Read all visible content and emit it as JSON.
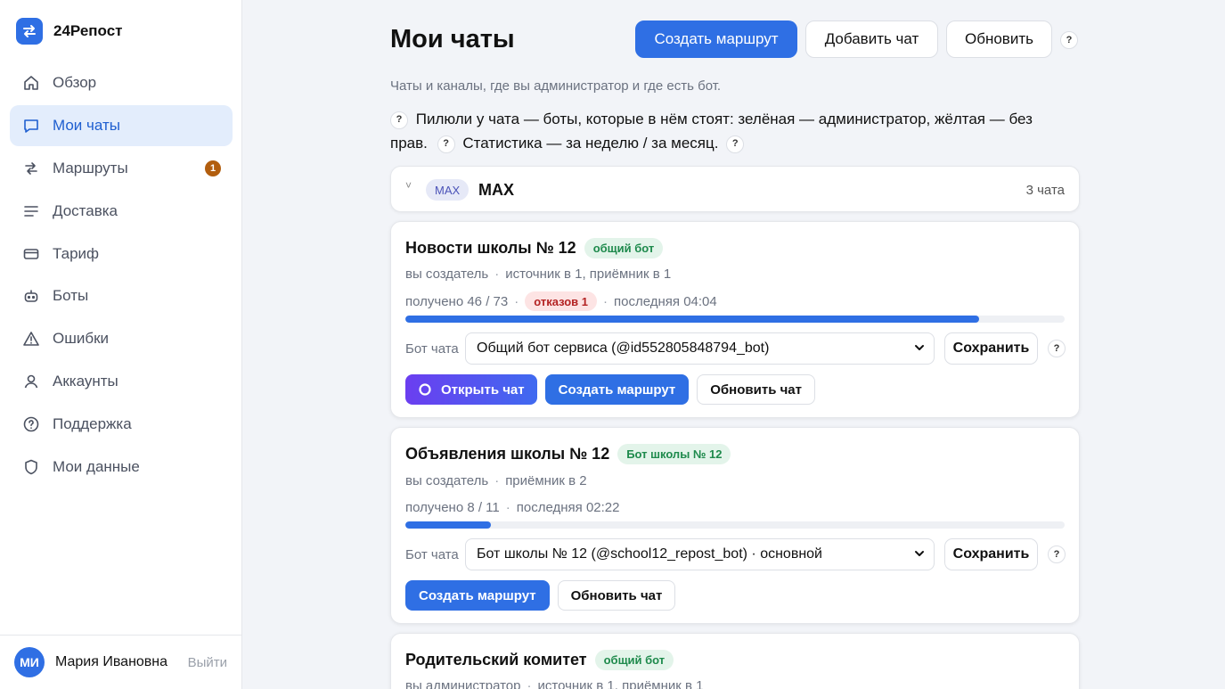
{
  "brand": {
    "name": "24Репост"
  },
  "sidebar": {
    "items": [
      {
        "label": "Обзор",
        "icon": "home-icon",
        "active": false
      },
      {
        "label": "Мои чаты",
        "icon": "chat-icon",
        "active": true
      },
      {
        "label": "Маршруты",
        "icon": "routes-icon",
        "active": false,
        "badge": "1"
      },
      {
        "label": "Доставка",
        "icon": "list-icon",
        "active": false
      },
      {
        "label": "Тариф",
        "icon": "card-icon",
        "active": false
      },
      {
        "label": "Боты",
        "icon": "bot-icon",
        "active": false
      },
      {
        "label": "Ошибки",
        "icon": "warning-icon",
        "active": false
      },
      {
        "label": "Аккаунты",
        "icon": "user-icon",
        "active": false
      },
      {
        "label": "Поддержка",
        "icon": "help-circle-icon",
        "active": false
      },
      {
        "label": "Мои данные",
        "icon": "shield-icon",
        "active": false
      }
    ]
  },
  "user": {
    "initials": "МИ",
    "name": "Мария Ивановна",
    "logout": "Выйти"
  },
  "header": {
    "title": "Мои чаты",
    "create_route": "Создать маршрут",
    "add_chat": "Добавить чат",
    "refresh": "Обновить",
    "help": "?"
  },
  "subtitle": "Чаты и каналы, где вы администратор и где есть бот.",
  "legend": {
    "part1": "Пилюли у чата — боты, которые в нём стоят: зелёная — администратор, жёлтая — без прав.",
    "part2": "Статистика — за неделю / за месяц."
  },
  "group": {
    "chevron": "˅",
    "tag": "MAX",
    "name": "MAX",
    "count": "3 чата"
  },
  "chats": [
    {
      "name": "Новости школы № 12",
      "pill": "общий бот",
      "meta_role": "вы создатель",
      "meta_links": "источник в 1, приёмник в 1",
      "received": "получено 46 / 73",
      "rejects": "отказов 1",
      "last": "последняя 04:04",
      "progress": 0.87,
      "bot_label": "Бот чата",
      "bot_value": "Общий бот сервиса (@id552805848794_bot)",
      "save": "Сохранить",
      "open_chat": "Открыть чат",
      "create_route": "Создать маршрут",
      "refresh_chat": "Обновить чат"
    },
    {
      "name": "Объявления школы № 12",
      "pill": "Бот школы № 12",
      "meta_role": "вы создатель",
      "meta_links": "приёмник в 2",
      "received": "получено 8 / 11",
      "last": "последняя 02:22",
      "progress": 0.13,
      "bot_label": "Бот чата",
      "bot_value": "Бот школы № 12 (@school12_repost_bot) · основной",
      "save": "Сохранить",
      "create_route": "Создать маршрут",
      "refresh_chat": "Обновить чат"
    },
    {
      "name": "Родительский комитет",
      "pill": "общий бот",
      "meta_role": "вы администратор",
      "meta_links": "источник в 1, приёмник в 1"
    }
  ],
  "colors": {
    "accent": "#2f6fe4",
    "active_bg": "#e3edfc",
    "badge": "#b25e0e",
    "pill_green_bg": "#e3f4ea",
    "pill_red_bg": "#fde4e4"
  }
}
